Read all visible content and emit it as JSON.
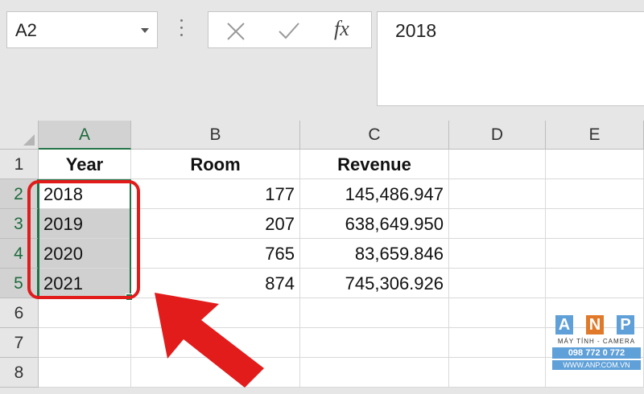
{
  "name_box": {
    "value": "A2"
  },
  "formula_bar": {
    "value": "2018",
    "fx_label": "fx"
  },
  "columns": [
    "A",
    "B",
    "C",
    "D",
    "E"
  ],
  "rows": [
    "1",
    "2",
    "3",
    "4",
    "5",
    "6",
    "7",
    "8"
  ],
  "header_row": {
    "a": "Year",
    "b": "Room",
    "c": "Revenue"
  },
  "data_rows": [
    {
      "a": "2018",
      "b": "177",
      "c": "145,486.947"
    },
    {
      "a": "2019",
      "b": "207",
      "c": "638,649.950"
    },
    {
      "a": "2020",
      "b": "765",
      "c": "83,659.846"
    },
    {
      "a": "2021",
      "b": "874",
      "c": "745,306.926"
    }
  ],
  "watermark": {
    "letters": [
      "A",
      "N",
      "P"
    ],
    "tagline": "MÁY TÍNH - CAMERA",
    "phone": "098 772 0 772",
    "website": "WWW.ANP.COM.VN"
  },
  "colors": {
    "selection": "#217346",
    "annotation": "#e21b1b"
  }
}
